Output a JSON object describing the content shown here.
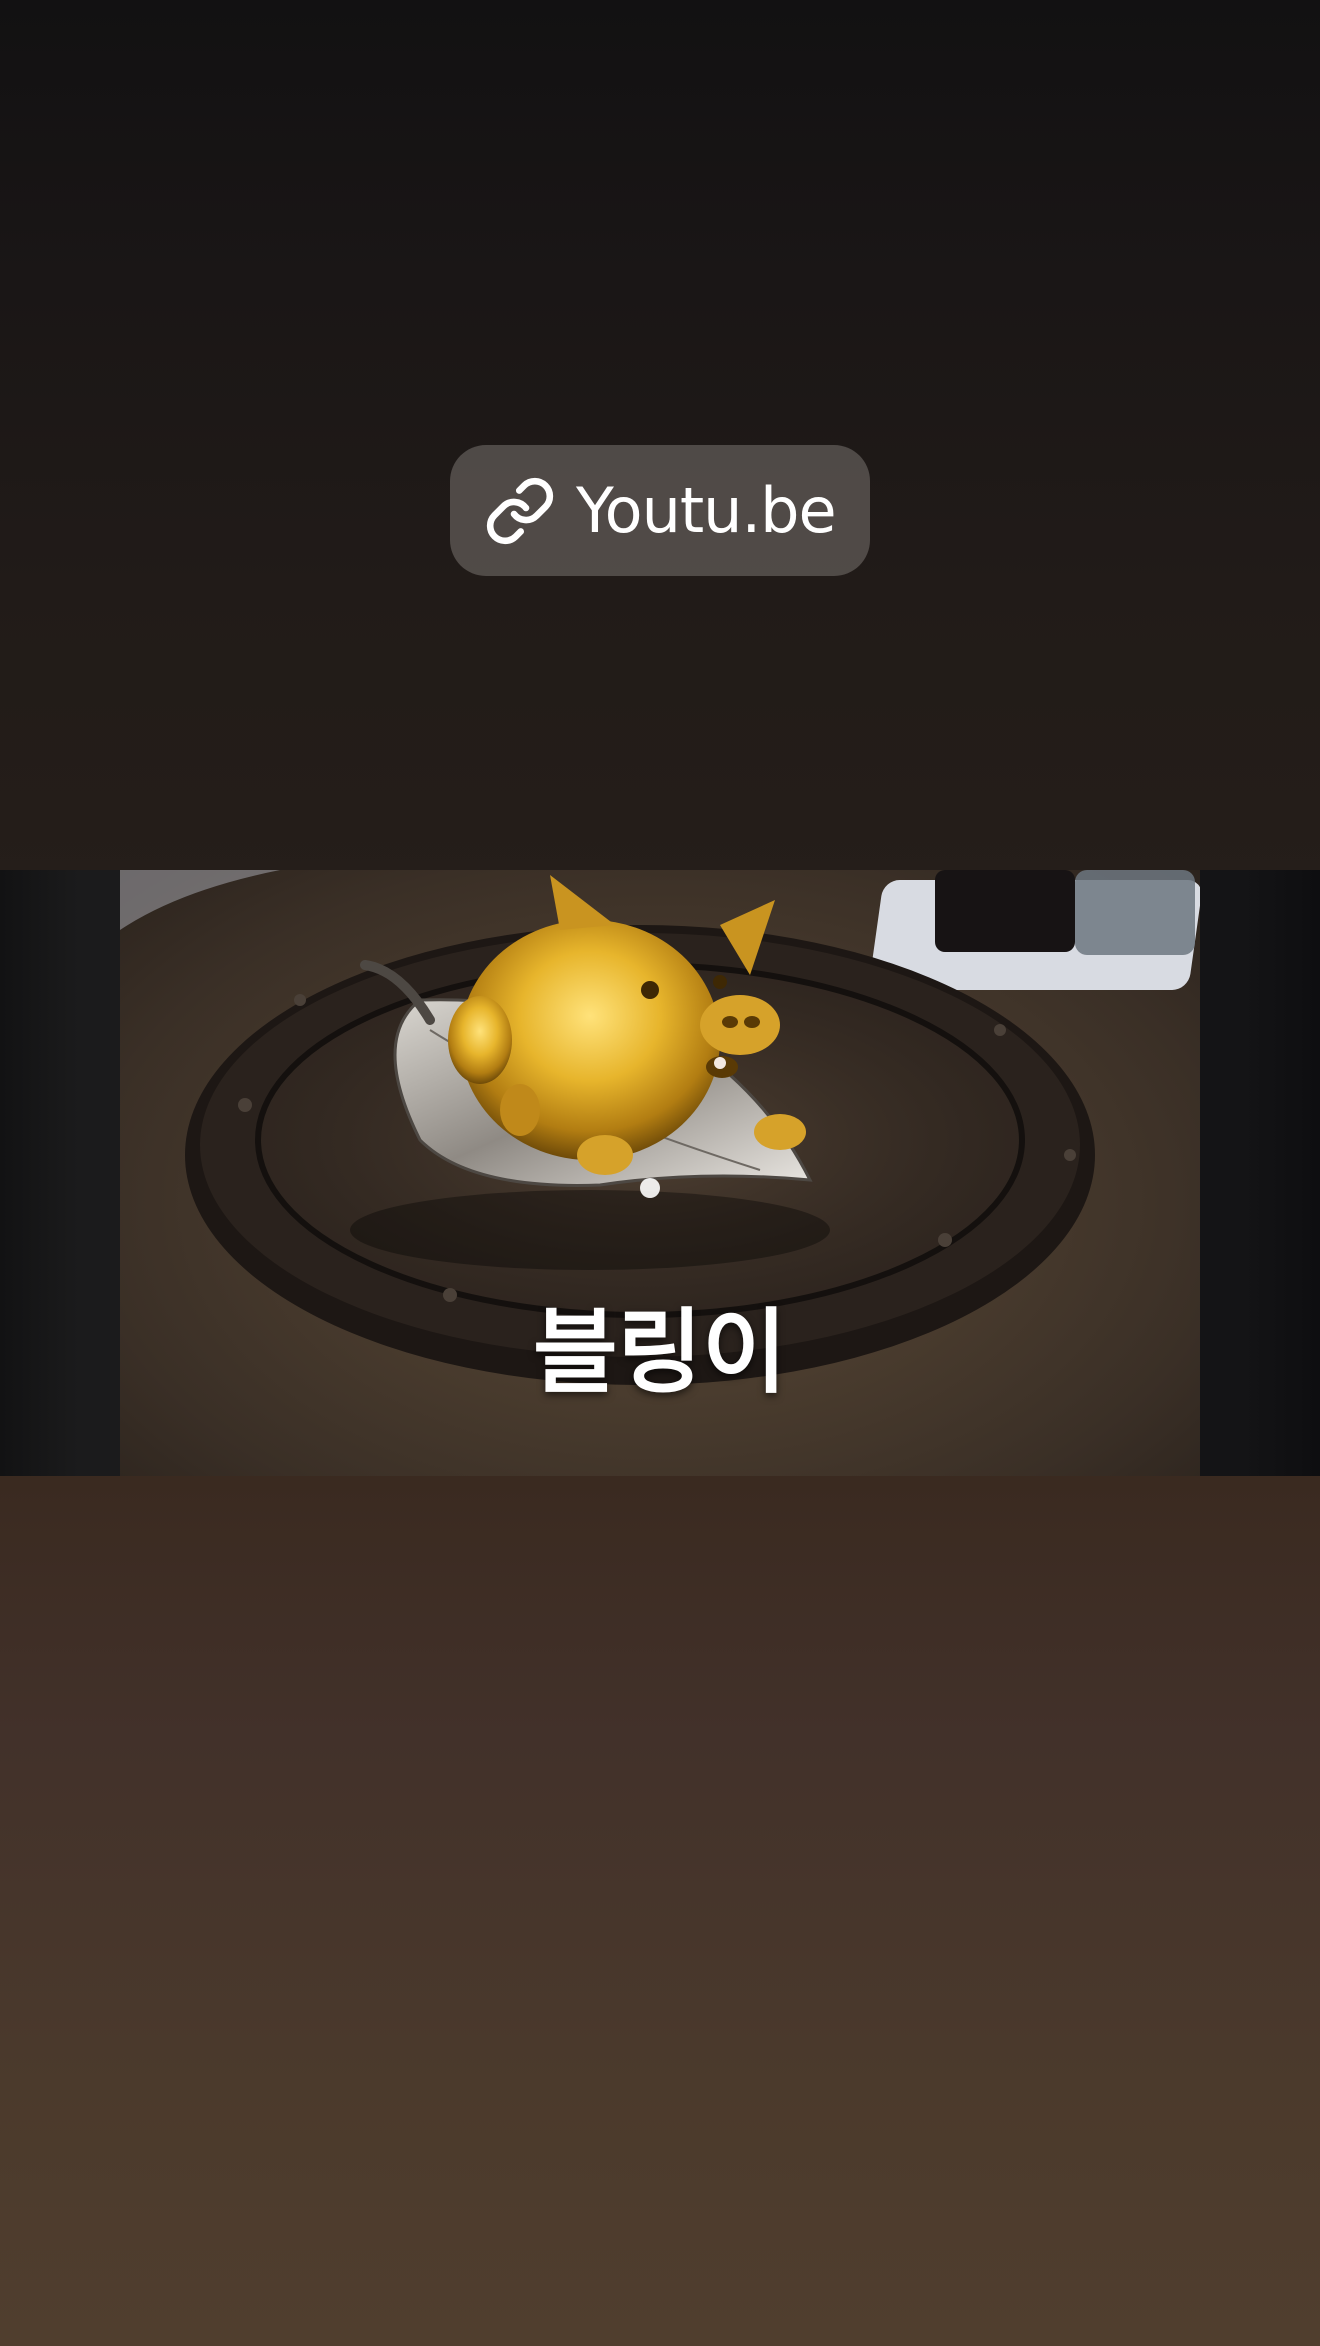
{
  "link_sticker": {
    "icon": "link-icon",
    "label": "Youtu.be"
  },
  "video_thumbnail": {
    "caption": "블링이",
    "subject": "golden-pig-figurine-image"
  },
  "colors": {
    "top_background": "#121112",
    "bottom_background": "#503e2e",
    "sticker_background": "#787370",
    "caption_text": "#ffffff"
  }
}
